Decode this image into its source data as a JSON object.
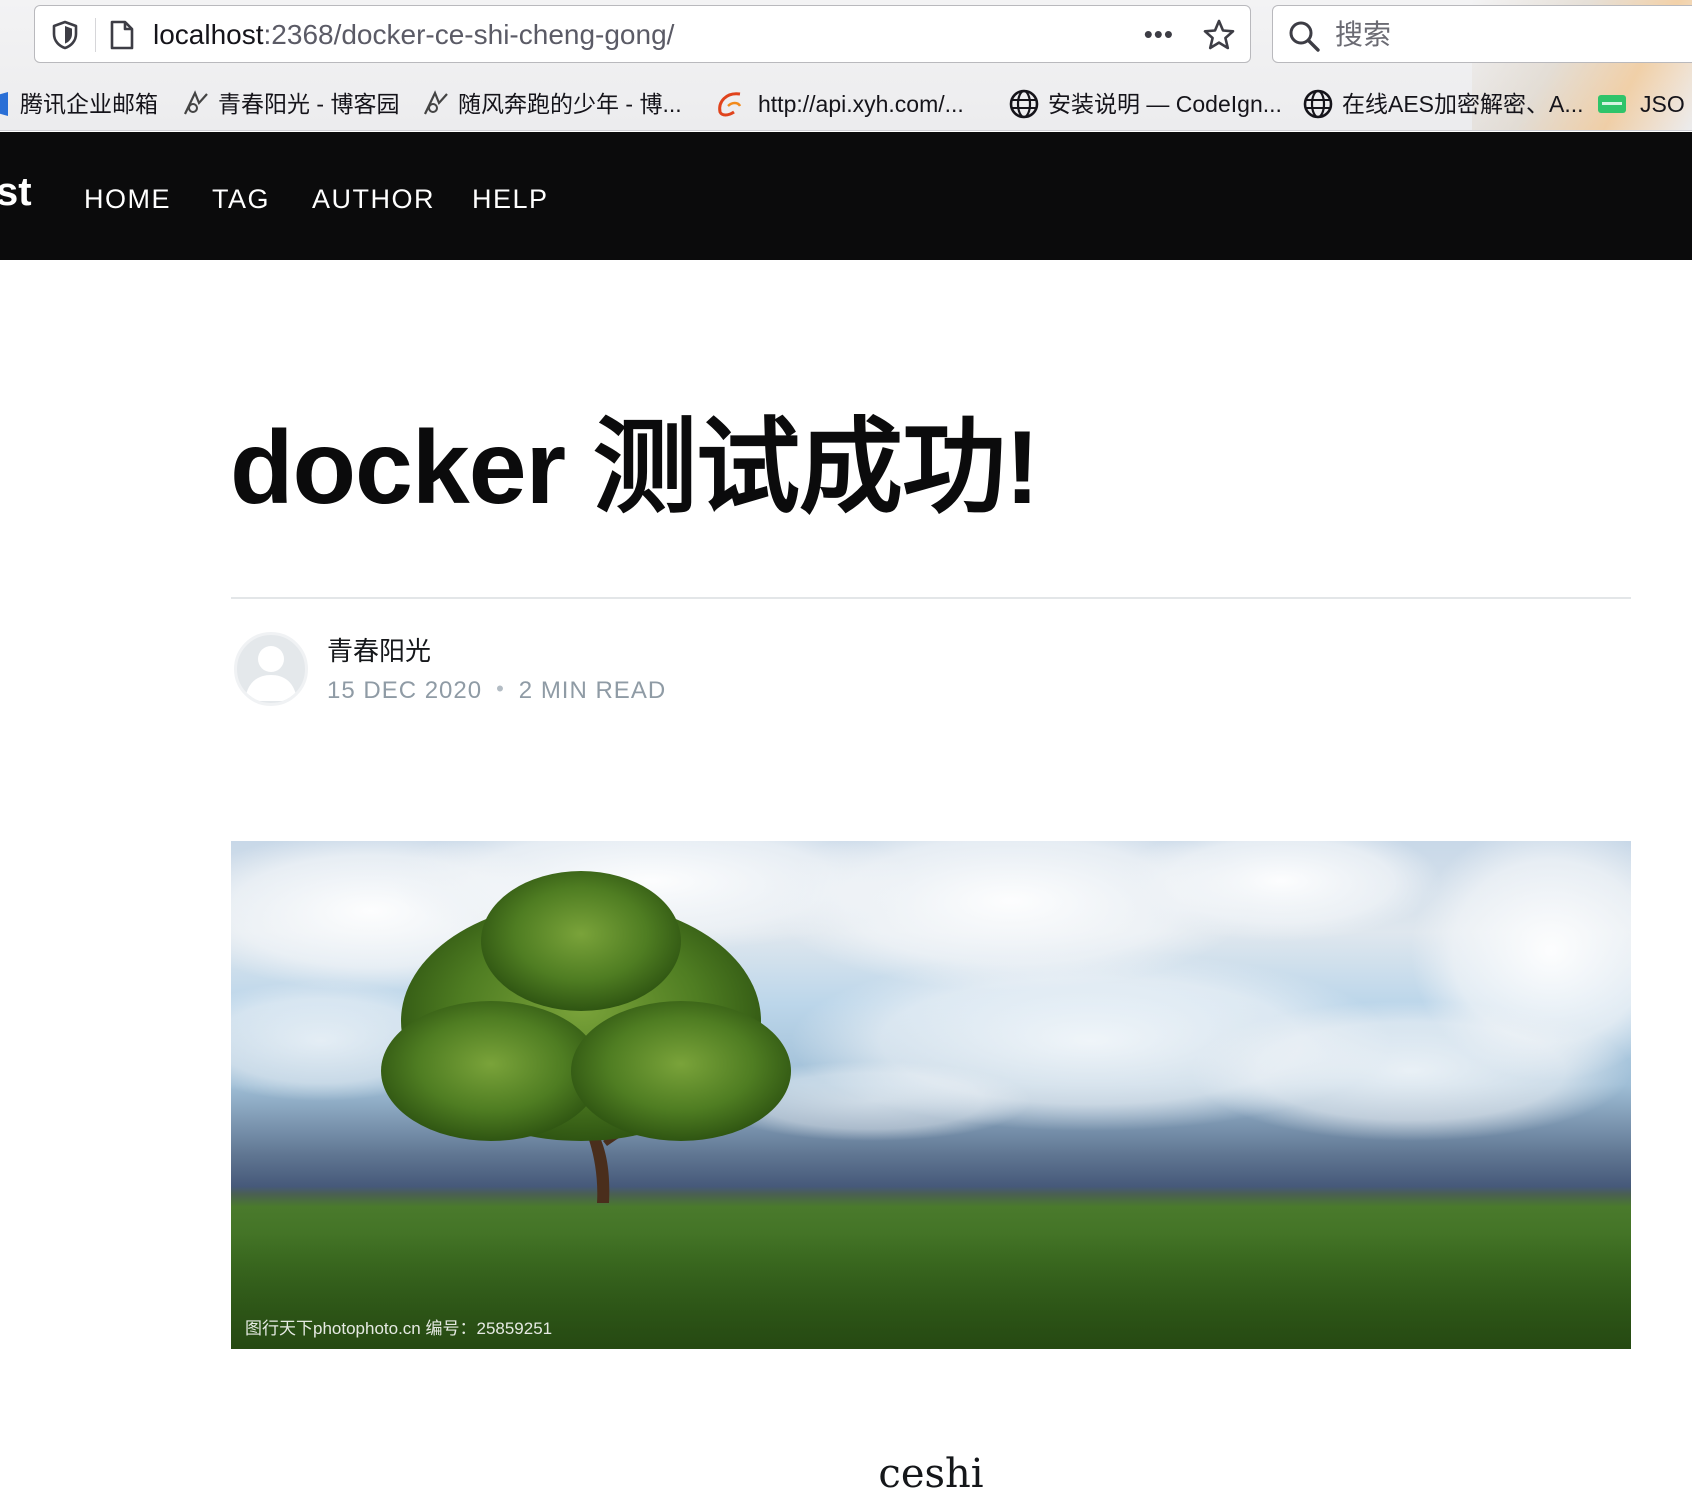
{
  "browser": {
    "url_host": "localhost",
    "url_path": ":2368/docker-ce-shi-cheng-gong/",
    "search_placeholder": "搜索",
    "bookmarks": [
      {
        "label": "腾讯企业邮箱",
        "icon": "tencent-mail-icon"
      },
      {
        "label": "青春阳光 - 博客园",
        "icon": "cnblogs-icon"
      },
      {
        "label": "随风奔跑的少年 - 博...",
        "icon": "cnblogs-icon"
      },
      {
        "label": "http://api.xyh.com/...",
        "icon": "site-swoosh-icon"
      },
      {
        "label": "安装说明 — CodeIgn...",
        "icon": "globe-icon"
      },
      {
        "label": "在线AES加密解密、A...",
        "icon": "globe-icon"
      },
      {
        "label": "JSO",
        "icon": "json-icon"
      }
    ]
  },
  "site": {
    "logo_fragment": "st",
    "nav": [
      "HOME",
      "TAG",
      "AUTHOR",
      "HELP"
    ]
  },
  "post": {
    "title": "docker 测试成功!",
    "author": "青春阳光",
    "date": "15 DEC 2020",
    "reading_time": "2 MIN READ",
    "image_watermark": "图行天下photophoto.cn  编号：25859251",
    "content": "ceshi"
  },
  "colors": {
    "nav_background": "#0b0b0c",
    "meta_text": "#8f9ba5"
  }
}
